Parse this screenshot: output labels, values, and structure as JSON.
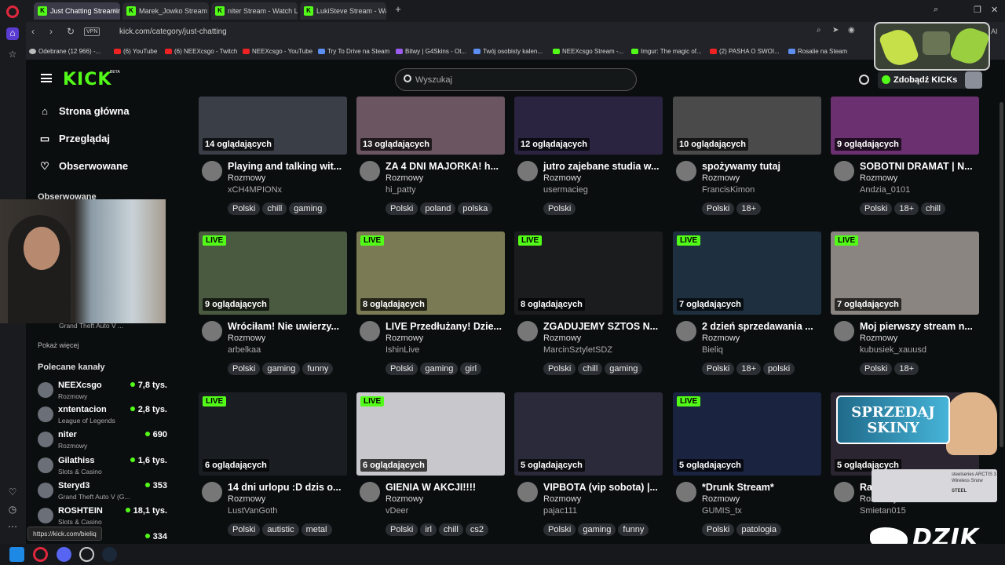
{
  "browser": {
    "tabs": [
      {
        "label": "Just Chatting Streaming -",
        "active": true
      },
      {
        "label": "Marek_Jowko Stream - W",
        "active": false
      },
      {
        "label": "niter Stream - Watch Live",
        "active": false
      },
      {
        "label": "LukiSteve Stream - Watch",
        "active": false
      }
    ],
    "vpn": "VPN",
    "url": "kick.com/category/just-chatting",
    "ai_label": "AI",
    "bookmarks": [
      "Odebrane (12 966) -...",
      "(6) YouTube",
      "(6) NEEXcsgo - Twitch",
      "NEEXcsgo - YouTube",
      "Try To Drive na Steam",
      "Bitwy | G4Skins - Ot...",
      "Twój osobisty kalen...",
      "NEEXcsgo Stream -...",
      "Imgur: The magic of...",
      "(2) PASHA O SWOI...",
      "Rosalie na Steam"
    ],
    "hover_url": "https://kick.com/bieliq"
  },
  "header": {
    "logo": "KICK",
    "beta": "BETA",
    "search_placeholder": "Wyszukaj",
    "get_kicks": "Zdobądź KICKs"
  },
  "sidebar": {
    "nav": [
      {
        "icon": "home-icon",
        "label": "Strona główna"
      },
      {
        "icon": "browse-icon",
        "label": "Przeglądaj"
      },
      {
        "icon": "heart-icon",
        "label": "Obserwowane"
      }
    ],
    "followed_title": "Obserwowane",
    "followed_partial_category": "Grand Theft Auto V ...",
    "show_more": "Pokaż więcej",
    "recommended_title": "Polecane kanały",
    "channels": [
      {
        "name": "NEEXcsgo",
        "category": "Rozmowy",
        "viewers": "7,8 tys."
      },
      {
        "name": "xntentacion",
        "category": "League of Legends",
        "viewers": "2,8 tys."
      },
      {
        "name": "niter",
        "category": "Rozmowy",
        "viewers": "690"
      },
      {
        "name": "Gilathiss",
        "category": "Slots & Casino",
        "viewers": "1,6 tys."
      },
      {
        "name": "Steryd3",
        "category": "Grand Theft Auto V (G...",
        "viewers": "353"
      },
      {
        "name": "ROSHTEIN",
        "category": "Slots & Casino",
        "viewers": "18,1 tys."
      },
      {
        "name": "",
        "category": "",
        "viewers": "334"
      }
    ]
  },
  "streams": [
    {
      "live": false,
      "viewers": "14 oglądających",
      "title": "Playing and talking wit...",
      "category": "Rozmowy",
      "user": "xCH4MPIONx",
      "tags": [
        "Polski",
        "chill",
        "gaming"
      ],
      "thumb": "#3a3f47"
    },
    {
      "live": false,
      "viewers": "13 oglądających",
      "title": "ZA 4 DNI MAJORKA! h...",
      "category": "Rozmowy",
      "user": "hi_patty",
      "tags": [
        "Polski",
        "poland",
        "polska"
      ],
      "thumb": "#6a5560"
    },
    {
      "live": false,
      "viewers": "12 oglądających",
      "title": "jutro zajebane studia w...",
      "category": "Rozmowy",
      "user": "usermacieg",
      "tags": [
        "Polski"
      ],
      "thumb": "#2a2440"
    },
    {
      "live": false,
      "viewers": "10 oglądających",
      "title": "spożywamy tutaj",
      "category": "Rozmowy",
      "user": "FrancisKimon",
      "tags": [
        "Polski",
        "18+"
      ],
      "thumb": "#4a4a4a"
    },
    {
      "live": false,
      "viewers": "9 oglądających",
      "title": "SOBOTNI DRAMAT | N...",
      "category": "Rozmowy",
      "user": "Andzia_0101",
      "tags": [
        "Polski",
        "18+",
        "chill"
      ],
      "thumb": "#6a3070"
    },
    {
      "live": true,
      "viewers": "9 oglądających",
      "title": "Wróciłam! Nie uwierzy...",
      "category": "Rozmowy",
      "user": "arbelkaa",
      "tags": [
        "Polski",
        "gaming",
        "funny"
      ],
      "thumb": "#4a5a40"
    },
    {
      "live": true,
      "viewers": "8 oglądających",
      "title": "LIVE Przedłużany! Dzie...",
      "category": "Rozmowy",
      "user": "IshinLive",
      "tags": [
        "Polski",
        "gaming",
        "girl"
      ],
      "thumb": "#7a7a55"
    },
    {
      "live": true,
      "viewers": "8 oglądających",
      "title": "ZGADUJEMY SZTOS N...",
      "category": "Rozmowy",
      "user": "MarcinSztyletSDZ",
      "tags": [
        "Polski",
        "chill",
        "gaming"
      ],
      "thumb": "#1a1c1e"
    },
    {
      "live": true,
      "viewers": "7 oglądających",
      "title": "2 dzień sprzedawania ...",
      "category": "Rozmowy",
      "user": "Bieliq",
      "tags": [
        "Polski",
        "18+",
        "polski"
      ],
      "thumb": "#1e3040"
    },
    {
      "live": true,
      "viewers": "7 oglądających",
      "title": "Moj pierwszy stream n...",
      "category": "Rozmowy",
      "user": "kubusiek_xauusd",
      "tags": [
        "Polski",
        "18+"
      ],
      "thumb": "#8a8580"
    },
    {
      "live": true,
      "viewers": "6 oglądających",
      "title": "14 dni urlopu :D dzis o...",
      "category": "Rozmowy",
      "user": "LustVanGoth",
      "tags": [
        "Polski",
        "autistic",
        "metal"
      ],
      "thumb": "#1a1e22"
    },
    {
      "live": true,
      "viewers": "6 oglądających",
      "title": "GIENIA W AKCJI!!!!",
      "category": "Rozmowy",
      "user": "vDeer",
      "tags": [
        "Polski",
        "irl",
        "chill",
        "cs2"
      ],
      "thumb": "#c8c8cc"
    },
    {
      "live": false,
      "viewers": "5 oglądających",
      "title": "VIPBOTA (vip sobota) |...",
      "category": "Rozmowy",
      "user": "pajac111",
      "tags": [
        "Polski",
        "gaming",
        "funny"
      ],
      "thumb": "#2a2a3a"
    },
    {
      "live": true,
      "viewers": "5 oglądających",
      "title": "*Drunk Stream*",
      "category": "Rozmowy",
      "user": "GUMIS_tx",
      "tags": [
        "Polski",
        "patologia"
      ],
      "thumb": "#1a2440"
    },
    {
      "live": false,
      "viewers": "5 oglądających",
      "title": "Ra...",
      "category": "Rozmowy",
      "user": "Smietan015",
      "tags": [],
      "thumb": "#2a2530"
    }
  ],
  "overlays": {
    "promo_text": "SPRZEDAJ SKINY",
    "steel_text": "steelseries ARCTIS 3 Wireless Snow",
    "steel_tag": "STEEL",
    "brand": "DZIK",
    "accent": "#53fc18"
  }
}
